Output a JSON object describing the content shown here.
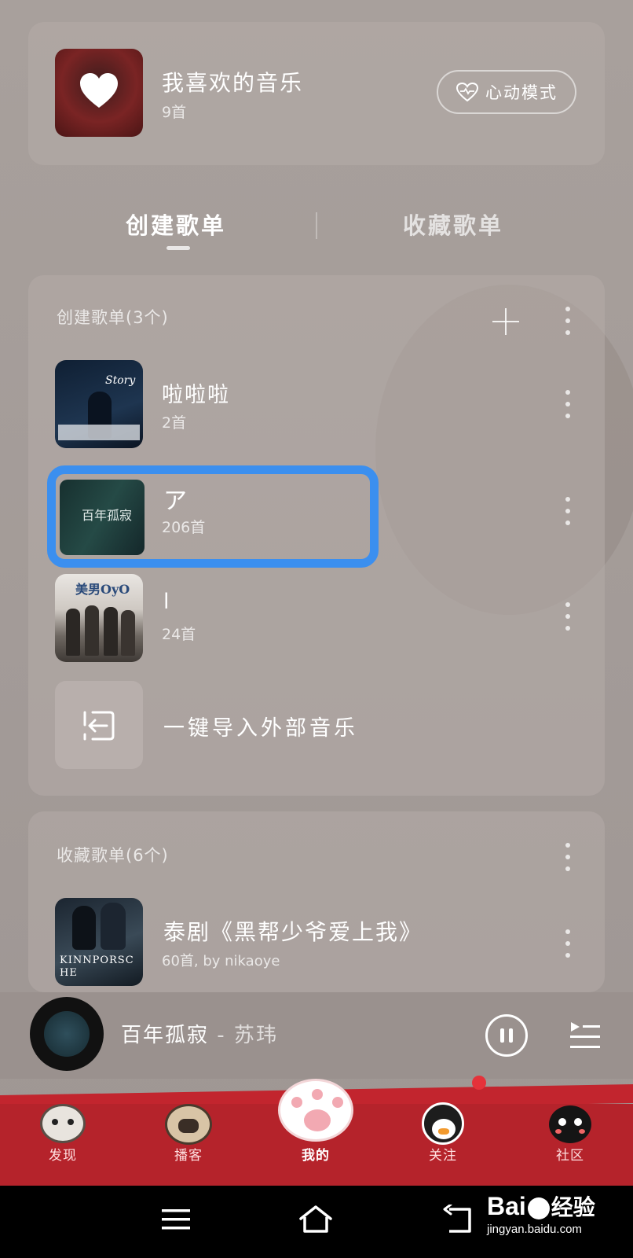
{
  "favorites": {
    "title": "我喜欢的音乐",
    "count": "9首",
    "heart_mode_label": "心动模式"
  },
  "tabs": {
    "created": "创建歌单",
    "collected": "收藏歌单"
  },
  "created_section": {
    "header": "创建歌单(3个)",
    "playlists": [
      {
        "title": "啦啦啦",
        "count": "2首",
        "cover_text": "Story"
      },
      {
        "title": "ア",
        "count": "206首",
        "cover_text": "百年孤寂"
      },
      {
        "title": "l",
        "count": "24首",
        "cover_text": "美男OyO"
      }
    ],
    "import_label": "一键导入外部音乐"
  },
  "collected_section": {
    "header": "收藏歌单(6个)",
    "playlists": [
      {
        "title": "泰剧《黑帮少爷爱上我》",
        "count": "60首, by nikaoye",
        "cover_text": "KINNPORSCHE"
      }
    ]
  },
  "player": {
    "song": "百年孤寂",
    "artist": " - 苏玮"
  },
  "bottom_nav": [
    {
      "label": "发现",
      "icon": "cat-mascot-icon"
    },
    {
      "label": "播客",
      "icon": "pug-mascot-icon"
    },
    {
      "label": "我的",
      "icon": "paw-icon",
      "active": true
    },
    {
      "label": "关注",
      "icon": "penguin-mascot-icon"
    },
    {
      "label": "社区",
      "icon": "black-cat-mascot-icon"
    }
  ],
  "watermark": {
    "brand": "Bai",
    "brand_cn": "经验",
    "url": "jingyan.baidu.com"
  },
  "colors": {
    "accent_highlight": "#3b8fef",
    "nav_red": "#b5232b"
  }
}
